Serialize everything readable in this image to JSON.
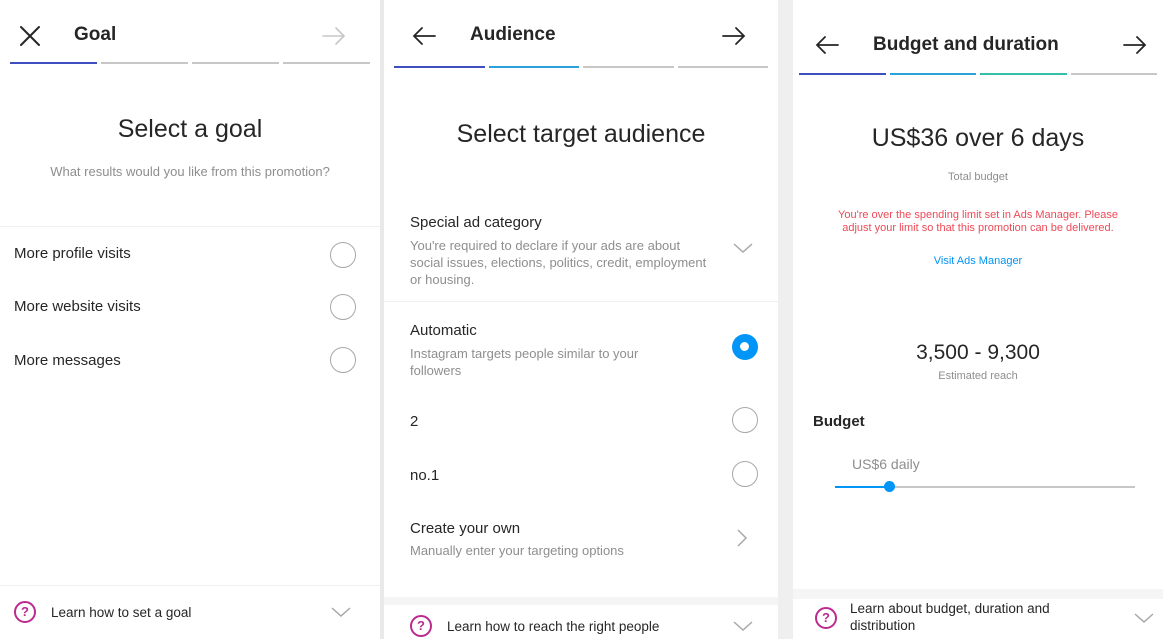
{
  "colors": {
    "accent_blue": "#0095f6",
    "warning_red": "#ed4956",
    "help_magenta": "#bc2a8d",
    "step_gradient": [
      "#3f4fbf",
      "#2aa1d8",
      "#35bfa8"
    ]
  },
  "goal": {
    "title": "Goal",
    "close_icon": "close-icon",
    "next_icon": "arrow-right-icon",
    "heading": "Select a goal",
    "subheading": "What results would you like from this promotion?",
    "options": [
      {
        "label": "More profile visits",
        "selected": false
      },
      {
        "label": "More website visits",
        "selected": false
      },
      {
        "label": "More messages",
        "selected": false
      }
    ],
    "footer_text": "Learn how to set a goal",
    "steps_completed": 1,
    "steps_total": 4
  },
  "audience": {
    "title": "Audience",
    "back_icon": "arrow-left-icon",
    "next_icon": "arrow-right-icon",
    "heading": "Select target audience",
    "special_title": "Special ad category",
    "special_desc": "You're required to declare if your ads are about social issues, elections, politics, credit, employment or housing.",
    "auto_title": "Automatic",
    "auto_desc": "Instagram targets people similar to your followers",
    "option_2": "2",
    "option_3": "no.1",
    "create_title": "Create your own",
    "create_desc": "Manually enter your targeting options",
    "footer_text": "Learn how to reach the right people",
    "steps_completed": 2,
    "steps_total": 4
  },
  "budget": {
    "title": "Budget and duration",
    "back_icon": "arrow-left-icon",
    "next_icon": "arrow-right-icon",
    "headline": "US$36 over 6 days",
    "headline_sub": "Total budget",
    "warning": "You're over the spending limit set in Ads Manager. Please adjust your limit so that this promotion can be delivered.",
    "link": "Visit Ads Manager",
    "reach": "3,500 - 9,300",
    "reach_sub": "Estimated reach",
    "section_label": "Budget",
    "slider_label": "US$6 daily",
    "slider_fraction": 0.18,
    "footer_text": "Learn about budget, duration and distribution",
    "steps_completed": 3,
    "steps_total": 4
  }
}
